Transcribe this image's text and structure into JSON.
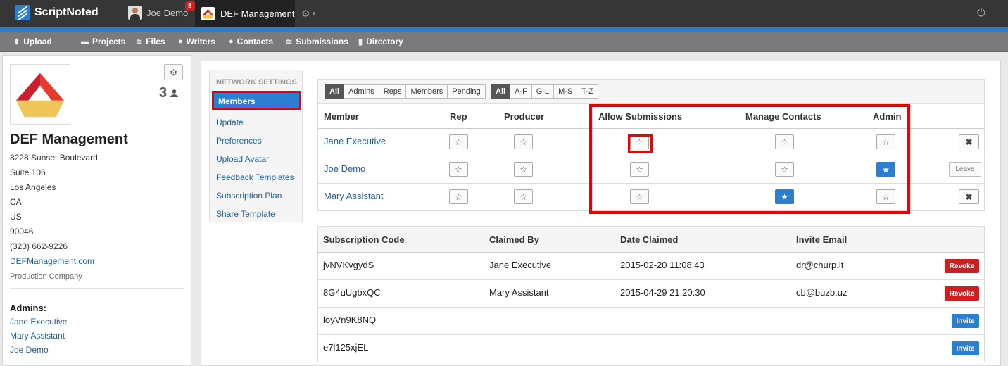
{
  "topbar": {
    "brand": "ScriptNoted",
    "user_name": "Joe Demo",
    "notification_count": "8",
    "active_org": "DEF Management",
    "settings_caret": "▾"
  },
  "nav": {
    "items": [
      {
        "label": "Upload",
        "icon": "upload-icon",
        "glyph": "⬆"
      },
      {
        "label": "Projects",
        "icon": "folder-icon",
        "glyph": "▬"
      },
      {
        "label": "Files",
        "icon": "files-icon",
        "glyph": "≋"
      },
      {
        "label": "Writers",
        "icon": "user-icon",
        "glyph": "●"
      },
      {
        "label": "Contacts",
        "icon": "contact-icon",
        "glyph": "●"
      },
      {
        "label": "Submissions",
        "icon": "stack-icon",
        "glyph": "≋"
      },
      {
        "label": "Directory",
        "icon": "book-icon",
        "glyph": "▮"
      }
    ]
  },
  "org": {
    "member_count": "3",
    "name": "DEF Management",
    "address_lines": [
      "8228 Sunset Boulevard",
      "Suite 106",
      "Los Angeles",
      "CA",
      "US",
      "90046",
      "(323) 662-9226"
    ],
    "website": "DEFManagement.com",
    "type": "Production Company",
    "admins_heading": "Admins:",
    "admins": [
      "Jane Executive",
      "Mary Assistant",
      "Joe Demo"
    ]
  },
  "settings_nav": {
    "heading": "NETWORK SETTINGS",
    "active": "Members",
    "items": [
      "Update",
      "Preferences",
      "Upload Avatar",
      "Feedback Templates",
      "Subscription Plan",
      "Share Template"
    ]
  },
  "filters": {
    "roles": [
      "All",
      "Admins",
      "Reps",
      "Members",
      "Pending"
    ],
    "active_role": "All",
    "alpha": [
      "All",
      "A-F",
      "G-L",
      "M-S",
      "T-Z"
    ],
    "active_alpha": "All"
  },
  "members_table": {
    "headers": {
      "member": "Member",
      "rep": "Rep",
      "producer": "Producer",
      "allow": "Allow Submissions",
      "manage": "Manage Contacts",
      "admin": "Admin"
    },
    "rows": [
      {
        "name": "Jane Executive",
        "rep": false,
        "producer": false,
        "allow": false,
        "manage": false,
        "admin": false,
        "action": "remove"
      },
      {
        "name": "Joe Demo",
        "rep": false,
        "producer": false,
        "allow": false,
        "manage": false,
        "admin": true,
        "action": "Leave"
      },
      {
        "name": "Mary Assistant",
        "rep": false,
        "producer": false,
        "allow": false,
        "manage": true,
        "admin": false,
        "action": "remove"
      }
    ]
  },
  "subscriptions_table": {
    "headers": {
      "code": "Subscription Code",
      "claimed_by": "Claimed By",
      "date": "Date Claimed",
      "email": "Invite Email"
    },
    "rows": [
      {
        "code": "jvNVKvgydS",
        "claimed_by": "Jane Executive",
        "date": "2015-02-20 11:08:43",
        "email": "dr@churp.it",
        "action": "Revoke"
      },
      {
        "code": "8G4uUgbxQC",
        "claimed_by": "Mary Assistant",
        "date": "2015-04-29 21:20:30",
        "email": "cb@buzb.uz",
        "action": "Revoke"
      },
      {
        "code": "loyVn9K8NQ",
        "claimed_by": "",
        "date": "",
        "email": "",
        "action": "Invite"
      },
      {
        "code": "e7l125xjEL",
        "claimed_by": "",
        "date": "",
        "email": "",
        "action": "Invite"
      }
    ]
  },
  "colors": {
    "accent": "#2b7fd0",
    "danger": "#cc1f1f",
    "highlight": "#e00000",
    "topbar": "#363636"
  },
  "icons": {
    "star": "☆",
    "star_on": "★",
    "remove": "✖",
    "gear": "⚙",
    "power": "⏻"
  }
}
